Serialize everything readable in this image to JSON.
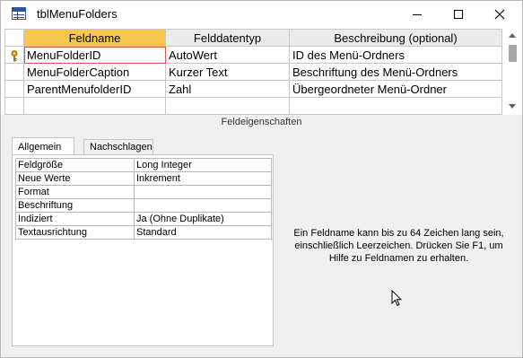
{
  "window": {
    "title": "tblMenuFolders"
  },
  "grid": {
    "headers": [
      "Feldname",
      "Felddatentyp",
      "Beschreibung (optional)"
    ],
    "rows": [
      {
        "name": "MenuFolderID",
        "type": "AutoWert",
        "desc": "ID des Menü-Ordners",
        "primary_key": true
      },
      {
        "name": "MenuFolderCaption",
        "type": "Kurzer Text",
        "desc": "Beschriftung des Menü-Ordners",
        "primary_key": false
      },
      {
        "name": "ParentMenufolderID",
        "type": "Zahl",
        "desc": "Übergeordneter Menü-Ordner",
        "primary_key": false
      },
      {
        "name": "",
        "type": "",
        "desc": "",
        "primary_key": false
      }
    ]
  },
  "properties": {
    "title": "Feldeigenschaften",
    "tabs": [
      "Allgemein",
      "Nachschlagen"
    ],
    "rows": [
      {
        "key": "Feldgröße",
        "value": "Long Integer"
      },
      {
        "key": "Neue Werte",
        "value": "Inkrement"
      },
      {
        "key": "Format",
        "value": ""
      },
      {
        "key": "Beschriftung",
        "value": ""
      },
      {
        "key": "Indiziert",
        "value": "Ja (Ohne Duplikate)"
      },
      {
        "key": "Textausrichtung",
        "value": "Standard"
      }
    ],
    "help_text": "Ein Feldname kann bis zu 64 Zeichen lang sein, einschließlich Leerzeichen. Drücken Sie F1, um Hilfe zu Feldnamen zu erhalten."
  },
  "colors": {
    "selected_header": "#f8c64a",
    "accent": "#2b579a"
  }
}
